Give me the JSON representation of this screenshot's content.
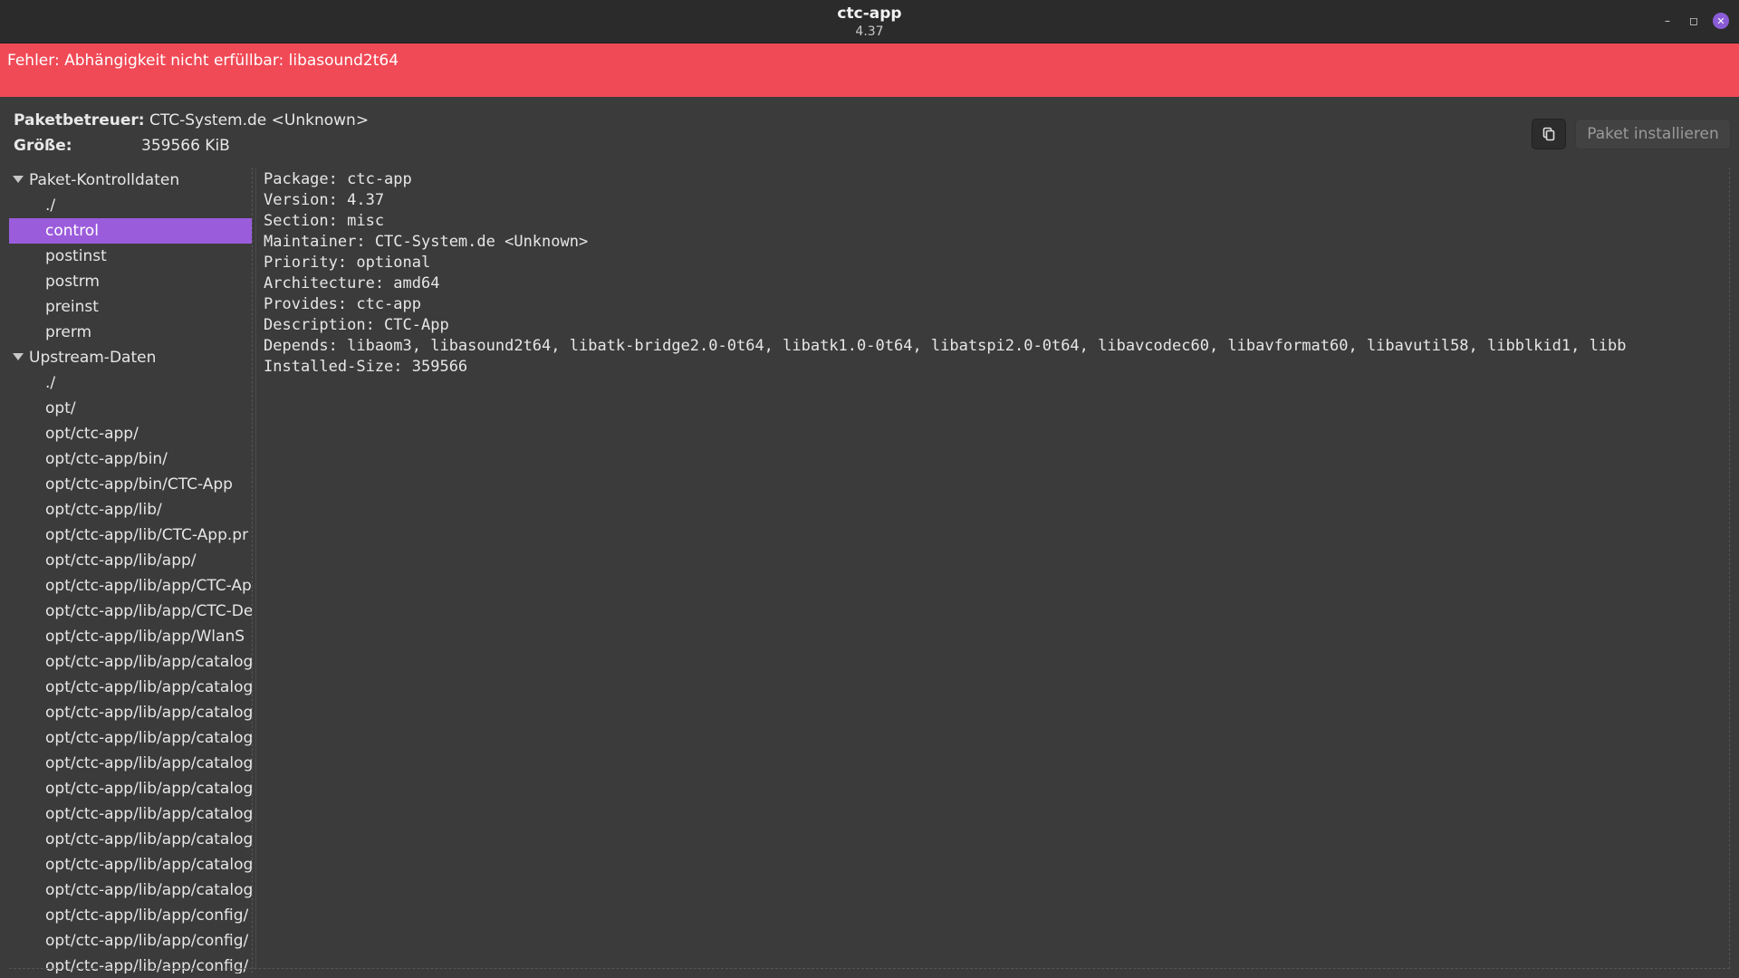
{
  "window": {
    "title": "ctc-app",
    "subtitle": "4.37",
    "minimize_glyph": "–",
    "maximize_glyph": "◻",
    "close_glyph": "✕"
  },
  "error": {
    "message": "Fehler: Abhängigkeit nicht erfüllbar: libasound2t64",
    "color": "#f04a56"
  },
  "info": {
    "maintainer_label": "Paketbetreuer:",
    "maintainer_value": "CTC-System.de <Unknown>",
    "size_label": "Größe:",
    "size_value": "359566 KiB"
  },
  "toolbar": {
    "copy_icon": "copy-icon",
    "install_label": "Paket installieren"
  },
  "tree": {
    "groups": [
      {
        "label": "Paket-Kontrolldaten",
        "items": [
          "./",
          "control",
          "postinst",
          "postrm",
          "preinst",
          "prerm"
        ]
      },
      {
        "label": "Upstream-Daten",
        "items": [
          "./",
          "opt/",
          "opt/ctc-app/",
          "opt/ctc-app/bin/",
          "opt/ctc-app/bin/CTC-App",
          "opt/ctc-app/lib/",
          "opt/ctc-app/lib/CTC-App.pr",
          "opt/ctc-app/lib/app/",
          "opt/ctc-app/lib/app/CTC-Ap",
          "opt/ctc-app/lib/app/CTC-De",
          "opt/ctc-app/lib/app/WlanS",
          "opt/ctc-app/lib/app/catalog",
          "opt/ctc-app/lib/app/catalog",
          "opt/ctc-app/lib/app/catalog",
          "opt/ctc-app/lib/app/catalog",
          "opt/ctc-app/lib/app/catalog",
          "opt/ctc-app/lib/app/catalog",
          "opt/ctc-app/lib/app/catalog",
          "opt/ctc-app/lib/app/catalog",
          "opt/ctc-app/lib/app/catalog",
          "opt/ctc-app/lib/app/catalog",
          "opt/ctc-app/lib/app/config/",
          "opt/ctc-app/lib/app/config/",
          "opt/ctc-app/lib/app/config/"
        ]
      }
    ],
    "selected": "control",
    "selection_color": "#9b5cdc"
  },
  "control_file": {
    "lines": [
      "Package: ctc-app",
      "Version: 4.37",
      "Section: misc",
      "Maintainer: CTC-System.de <Unknown>",
      "Priority: optional",
      "Architecture: amd64",
      "Provides: ctc-app",
      "Description: CTC-App",
      "Depends: libaom3, libasound2t64, libatk-bridge2.0-0t64, libatk1.0-0t64, libatspi2.0-0t64, libavcodec60, libavformat60, libavutil58, libblkid1, libb",
      "Installed-Size: 359566"
    ]
  }
}
